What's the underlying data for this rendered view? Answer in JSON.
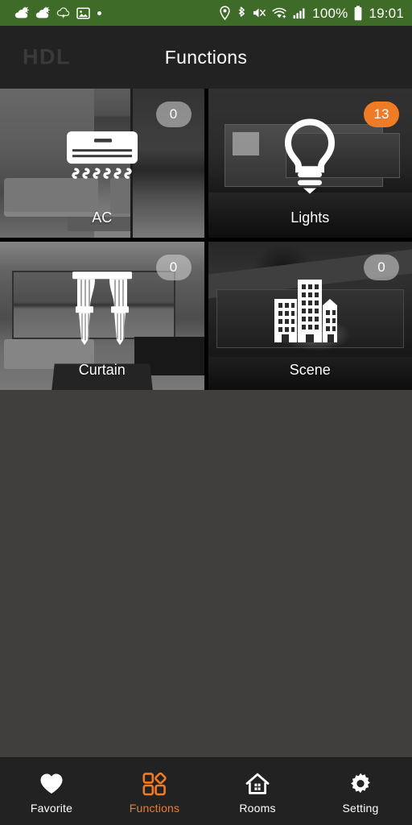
{
  "statusbar": {
    "background_color": "#3E6B27",
    "left_icons": [
      {
        "name": "weather-partly-cloudy-icon"
      },
      {
        "name": "weather-partly-cloudy-icon"
      },
      {
        "name": "weather-storm-cloud-icon"
      },
      {
        "name": "image-icon"
      },
      {
        "name": "dot-indicator-icon"
      }
    ],
    "right_icons": [
      {
        "name": "location-pin-icon"
      },
      {
        "name": "bluetooth-icon"
      },
      {
        "name": "volume-mute-icon"
      },
      {
        "name": "wifi-icon"
      },
      {
        "name": "cellular-signal-icon"
      }
    ],
    "battery_percent": "100%",
    "battery_icon": "battery-full-icon",
    "clock": "19:01"
  },
  "header": {
    "logo": "HDL",
    "title": "Functions",
    "background_color": "#232222"
  },
  "accent_color": "#F07B26",
  "page_background_color": "#413F3D",
  "tiles": [
    {
      "id": "ac",
      "label": "AC",
      "badge": "0",
      "badge_active": false,
      "icon": "air-conditioner-icon"
    },
    {
      "id": "lights",
      "label": "Lights",
      "badge": "13",
      "badge_active": true,
      "icon": "lightbulb-icon"
    },
    {
      "id": "curtain",
      "label": "Curtain",
      "badge": "0",
      "badge_active": false,
      "icon": "curtain-icon"
    },
    {
      "id": "scene",
      "label": "Scene",
      "badge": "0",
      "badge_active": false,
      "icon": "buildings-icon"
    }
  ],
  "bottomnav": {
    "items": [
      {
        "id": "favorite",
        "label": "Favorite",
        "icon": "heart-icon",
        "active": false
      },
      {
        "id": "functions",
        "label": "Functions",
        "icon": "function-grid-icon",
        "active": true
      },
      {
        "id": "rooms",
        "label": "Rooms",
        "icon": "home-icon",
        "active": false
      },
      {
        "id": "setting",
        "label": "Setting",
        "icon": "gear-icon",
        "active": false
      }
    ]
  }
}
